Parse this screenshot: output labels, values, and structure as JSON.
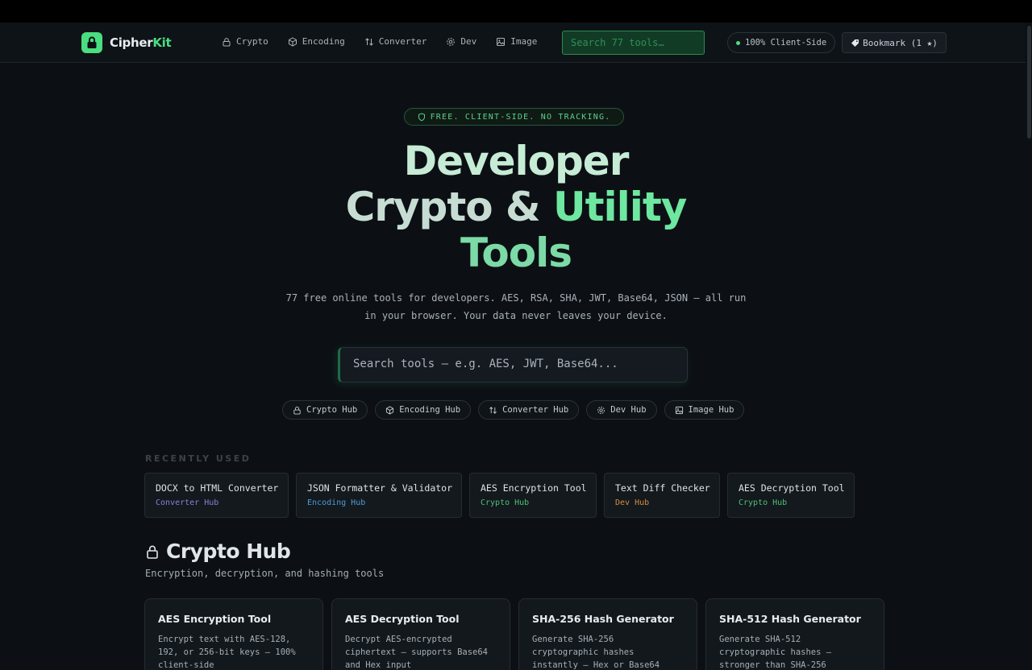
{
  "nav": {
    "brand_main": "Cipher",
    "brand_accent": "Kit",
    "links": [
      {
        "label": "Crypto",
        "icon": "lock-icon"
      },
      {
        "label": "Encoding",
        "icon": "cube-icon"
      },
      {
        "label": "Converter",
        "icon": "swap-icon"
      },
      {
        "label": "Dev",
        "icon": "gear-icon"
      },
      {
        "label": "Image",
        "icon": "image-icon"
      }
    ],
    "search_placeholder": "Search 77 tools…",
    "client_badge": "100% Client-Side",
    "bookmark_label": "Bookmark (1 ★)"
  },
  "hero": {
    "pill": "FREE. CLIENT-SIDE. NO TRACKING.",
    "title_line1": "Developer",
    "title_line2a": "Crypto & ",
    "title_line2b": "Utility",
    "title_line3": "Tools",
    "subtitle_line1": "77 free online tools for developers. AES, RSA, SHA, JWT, Base64, JSON — all run",
    "subtitle_line2": "in your browser. Your data never leaves your device.",
    "search_placeholder": "Search tools — e.g. AES, JWT, Base64...",
    "hubs": [
      {
        "label": "Crypto Hub",
        "icon": "lock-icon"
      },
      {
        "label": "Encoding Hub",
        "icon": "cube-icon"
      },
      {
        "label": "Converter Hub",
        "icon": "swap-icon"
      },
      {
        "label": "Dev Hub",
        "icon": "gear-icon"
      },
      {
        "label": "Image Hub",
        "icon": "image-icon"
      }
    ]
  },
  "recent": {
    "title": "RECENTLY USED",
    "items": [
      {
        "title": "DOCX to HTML Converter",
        "hub": "Converter Hub",
        "color": "#8b7fd9"
      },
      {
        "title": "JSON Formatter & Validator",
        "hub": "Encoding Hub",
        "color": "#4f9ad8"
      },
      {
        "title": "AES Encryption Tool",
        "hub": "Crypto Hub",
        "color": "#4fbf7a"
      },
      {
        "title": "Text Diff Checker",
        "hub": "Dev Hub",
        "color": "#d98a3f"
      },
      {
        "title": "AES Decryption Tool",
        "hub": "Crypto Hub",
        "color": "#4fbf7a"
      }
    ]
  },
  "crypto_section": {
    "title": "Crypto Hub",
    "subtitle": "Encryption, decryption, and hashing tools",
    "tools": [
      {
        "title": "AES Encryption Tool",
        "desc_lines": [
          "Encrypt text with AES-128,",
          "192, or 256-bit keys — 100%",
          "client-side"
        ]
      },
      {
        "title": "AES Decryption Tool",
        "desc_lines": [
          "Decrypt AES-encrypted",
          "ciphertext — supports Base64",
          "and Hex input"
        ]
      },
      {
        "title": "SHA-256 Hash Generator",
        "desc_lines": [
          "Generate SHA-256",
          "cryptographic hashes",
          "instantly — Hex or Base64"
        ]
      },
      {
        "title": "SHA-512 Hash Generator",
        "desc_lines": [
          "Generate SHA-512",
          "cryptographic hashes —",
          "stronger than SHA-256"
        ]
      }
    ]
  },
  "colors": {
    "accent": "#4ade80",
    "background": "#0c1014"
  }
}
